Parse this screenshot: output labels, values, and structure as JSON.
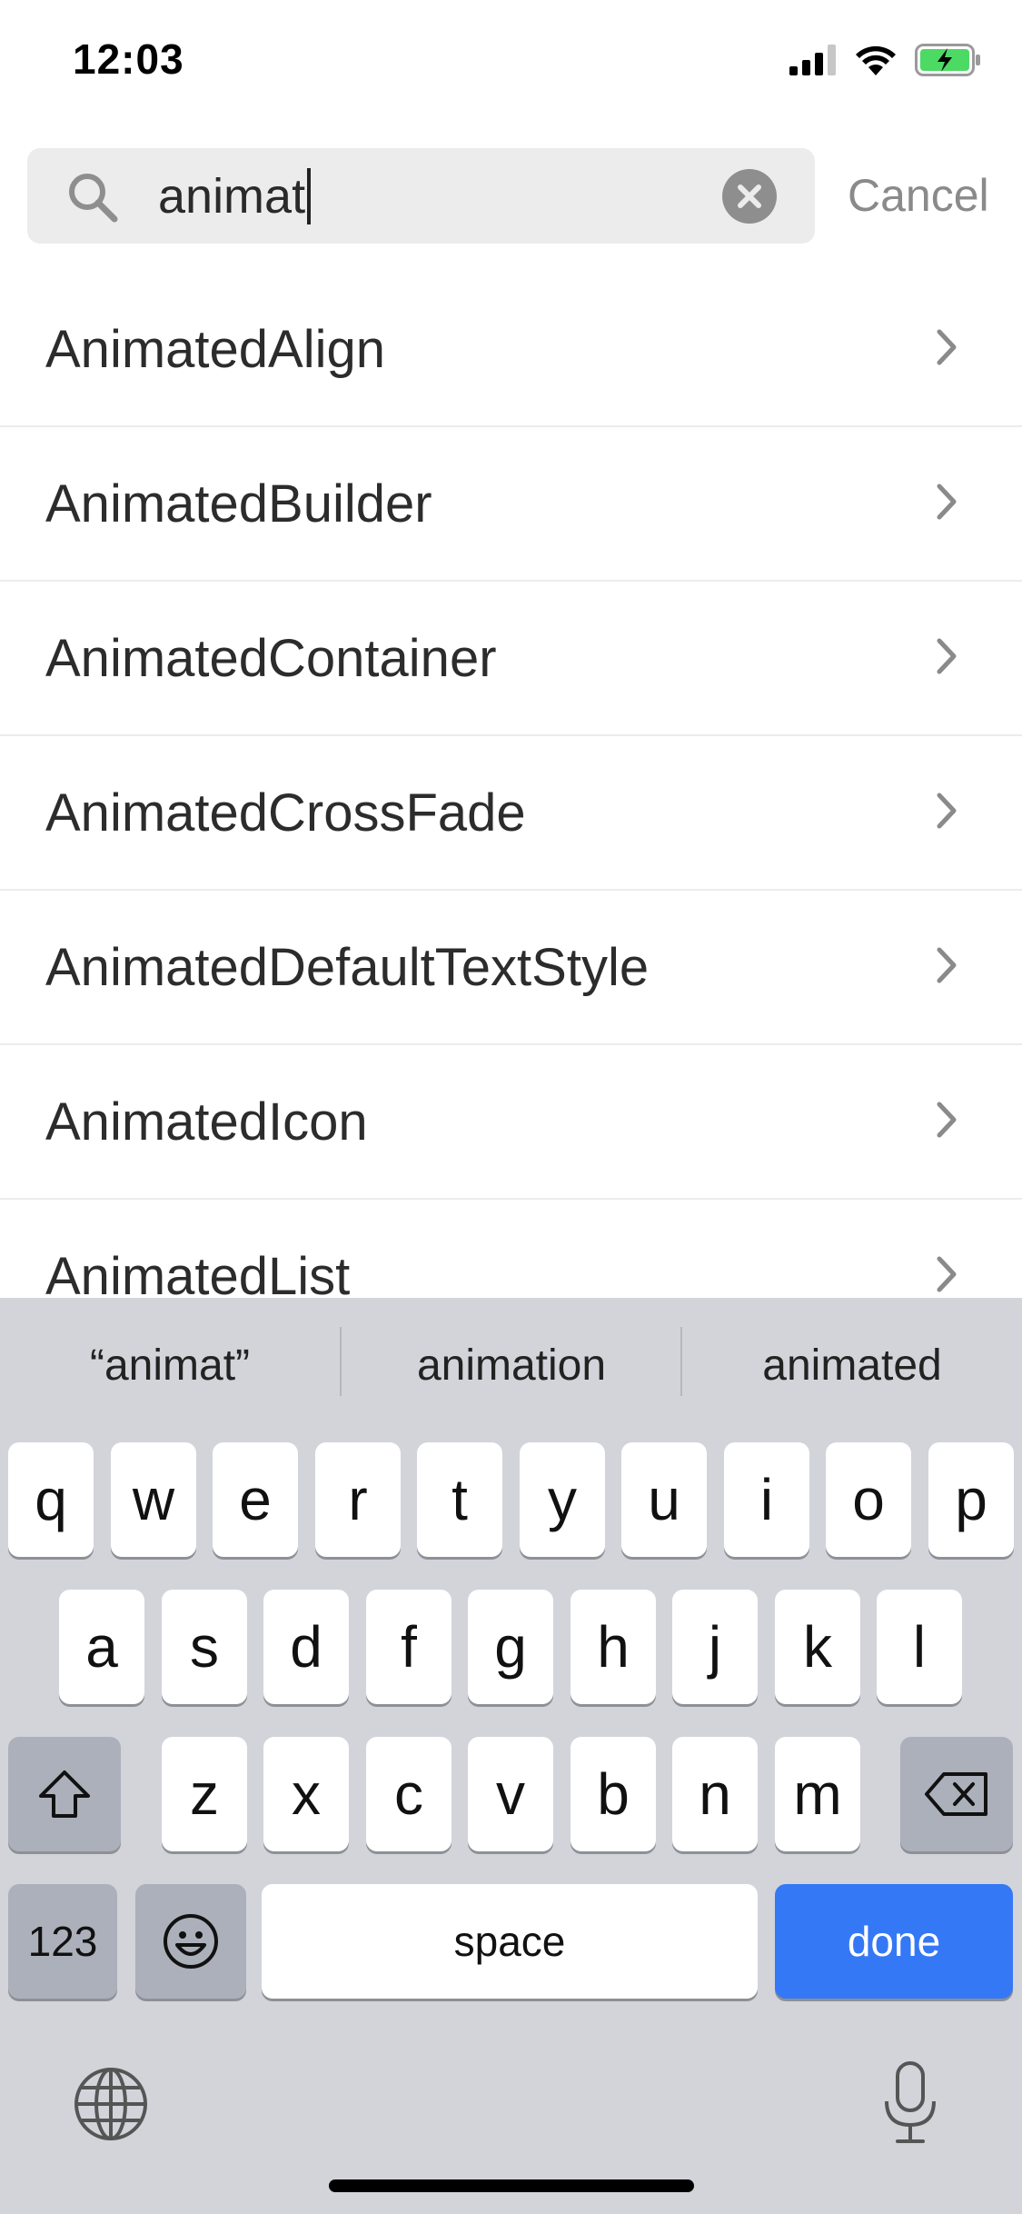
{
  "status_bar": {
    "time": "12:03",
    "signal_icon": "cellular-signal-icon",
    "wifi_icon": "wifi-icon",
    "battery_icon": "battery-charging-icon",
    "battery_color": "#4cd964"
  },
  "search": {
    "value": "animat",
    "cancel_label": "Cancel"
  },
  "results": [
    {
      "label": "AnimatedAlign"
    },
    {
      "label": "AnimatedBuilder"
    },
    {
      "label": "AnimatedContainer"
    },
    {
      "label": "AnimatedCrossFade"
    },
    {
      "label": "AnimatedDefaultTextStyle"
    },
    {
      "label": "AnimatedIcon"
    },
    {
      "label": "AnimatedList"
    }
  ],
  "keyboard": {
    "suggestions": [
      "“animat”",
      "animation",
      "animated"
    ],
    "row1": [
      "q",
      "w",
      "e",
      "r",
      "t",
      "y",
      "u",
      "i",
      "o",
      "p"
    ],
    "row2": [
      "a",
      "s",
      "d",
      "f",
      "g",
      "h",
      "j",
      "k",
      "l"
    ],
    "row3": [
      "z",
      "x",
      "c",
      "v",
      "b",
      "n",
      "m"
    ],
    "numbers_label": "123",
    "space_label": "space",
    "done_label": "done",
    "accent_color": "#3478f6"
  }
}
